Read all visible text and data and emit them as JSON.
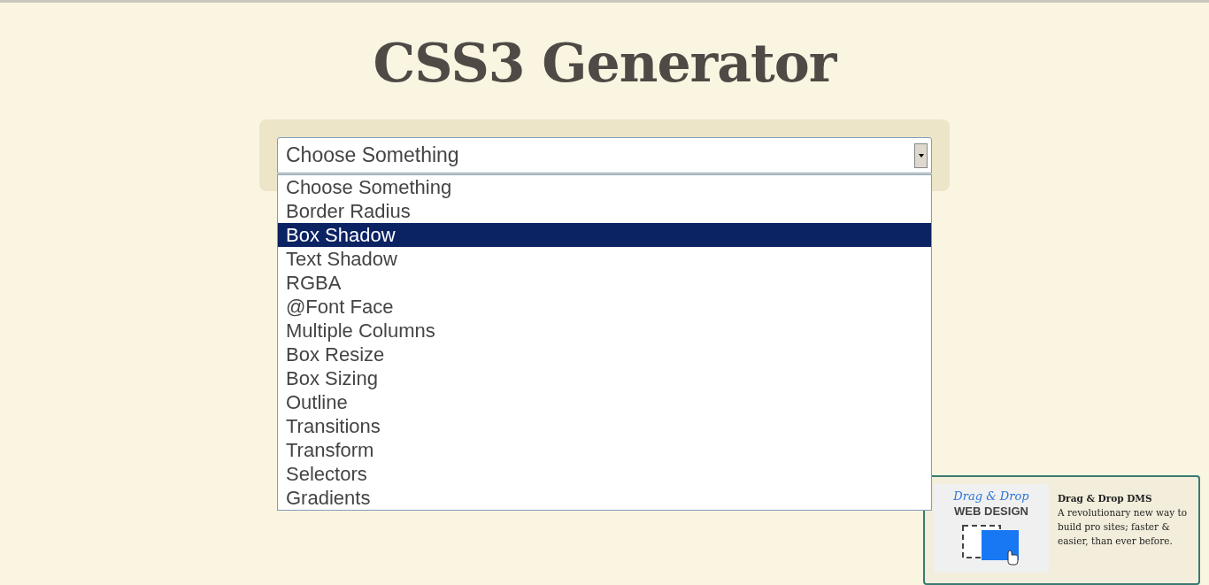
{
  "page": {
    "title": "CSS3 Generator"
  },
  "select": {
    "value": "Choose Something",
    "expanded": true,
    "options": [
      {
        "label": "Choose Something",
        "highlighted": false
      },
      {
        "label": "Border Radius",
        "highlighted": false
      },
      {
        "label": "Box Shadow",
        "highlighted": true
      },
      {
        "label": "Text Shadow",
        "highlighted": false
      },
      {
        "label": "RGBA",
        "highlighted": false
      },
      {
        "label": "@Font Face",
        "highlighted": false
      },
      {
        "label": "Multiple Columns",
        "highlighted": false
      },
      {
        "label": "Box Resize",
        "highlighted": false
      },
      {
        "label": "Box Sizing",
        "highlighted": false
      },
      {
        "label": "Outline",
        "highlighted": false
      },
      {
        "label": "Transitions",
        "highlighted": false
      },
      {
        "label": "Transform",
        "highlighted": false
      },
      {
        "label": "Selectors",
        "highlighted": false
      },
      {
        "label": "Gradients",
        "highlighted": false
      }
    ]
  },
  "ad": {
    "image_line_1": "Drag & Drop",
    "image_line_2": "WEB DESIGN",
    "title": "Drag & Drop DMS",
    "text": "A revolutionary new way to build pro sites; faster & easier, than ever before."
  }
}
